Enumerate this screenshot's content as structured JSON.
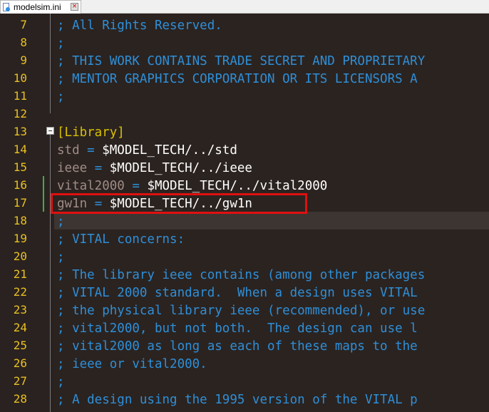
{
  "tab": {
    "title": "modelsim.ini",
    "close": "×"
  },
  "lines": [
    {
      "num": "7",
      "segments": [
        {
          "cls": "comment",
          "text": "; All Rights Reserved."
        }
      ]
    },
    {
      "num": "8",
      "segments": [
        {
          "cls": "comment",
          "text": ";"
        }
      ]
    },
    {
      "num": "9",
      "segments": [
        {
          "cls": "comment",
          "text": "; THIS WORK CONTAINS TRADE SECRET AND PROPRIETARY"
        }
      ]
    },
    {
      "num": "10",
      "segments": [
        {
          "cls": "comment",
          "text": "; MENTOR GRAPHICS CORPORATION OR ITS LICENSORS A"
        }
      ]
    },
    {
      "num": "11",
      "segments": [
        {
          "cls": "comment",
          "text": ";"
        }
      ]
    },
    {
      "num": "12",
      "segments": []
    },
    {
      "num": "13",
      "segments": [
        {
          "cls": "section",
          "text": "[Library]"
        }
      ]
    },
    {
      "num": "14",
      "segments": [
        {
          "cls": "key",
          "text": "std"
        },
        {
          "cls": "op",
          "text": " = "
        },
        {
          "cls": "value",
          "text": "$MODEL_TECH/../std"
        }
      ]
    },
    {
      "num": "15",
      "segments": [
        {
          "cls": "key",
          "text": "ieee"
        },
        {
          "cls": "op",
          "text": " = "
        },
        {
          "cls": "value",
          "text": "$MODEL_TECH/../ieee"
        }
      ]
    },
    {
      "num": "16",
      "segments": [
        {
          "cls": "key",
          "text": "vital2000"
        },
        {
          "cls": "op",
          "text": " = "
        },
        {
          "cls": "value",
          "text": "$MODEL_TECH/../vital2000"
        }
      ]
    },
    {
      "num": "17",
      "segments": [
        {
          "cls": "key",
          "text": "gw1n"
        },
        {
          "cls": "op",
          "text": " = "
        },
        {
          "cls": "value",
          "text": "$MODEL_TECH/../gw1n"
        }
      ]
    },
    {
      "num": "18",
      "segments": [
        {
          "cls": "comment",
          "text": ";"
        }
      ]
    },
    {
      "num": "19",
      "segments": [
        {
          "cls": "comment",
          "text": "; VITAL concerns:"
        }
      ]
    },
    {
      "num": "20",
      "segments": [
        {
          "cls": "comment",
          "text": ";"
        }
      ]
    },
    {
      "num": "21",
      "segments": [
        {
          "cls": "comment",
          "text": "; The library ieee contains (among other packages"
        }
      ]
    },
    {
      "num": "22",
      "segments": [
        {
          "cls": "comment",
          "text": "; VITAL 2000 standard.  When a design uses VITAL"
        }
      ]
    },
    {
      "num": "23",
      "segments": [
        {
          "cls": "comment",
          "text": "; the physical library ieee (recommended), or use"
        }
      ]
    },
    {
      "num": "24",
      "segments": [
        {
          "cls": "comment",
          "text": "; vital2000, but not both.  The design can use l"
        }
      ]
    },
    {
      "num": "25",
      "segments": [
        {
          "cls": "comment",
          "text": "; vital2000 as long as each of these maps to the"
        }
      ]
    },
    {
      "num": "26",
      "segments": [
        {
          "cls": "comment",
          "text": "; ieee or vital2000."
        }
      ]
    },
    {
      "num": "27",
      "segments": [
        {
          "cls": "comment",
          "text": ";"
        }
      ]
    },
    {
      "num": "28",
      "segments": [
        {
          "cls": "comment",
          "text": "; A design using the 1995 version of the VITAL p"
        }
      ]
    }
  ],
  "current_line": "18",
  "modified_lines": [
    "16",
    "17"
  ],
  "highlighted_line": "17",
  "colors": {
    "background": "#2b2320",
    "line_number": "#e8c020",
    "comment": "#2e8fd8",
    "section": "#d8c000",
    "highlight": "#e01010",
    "modified_marker": "#3cb043"
  }
}
